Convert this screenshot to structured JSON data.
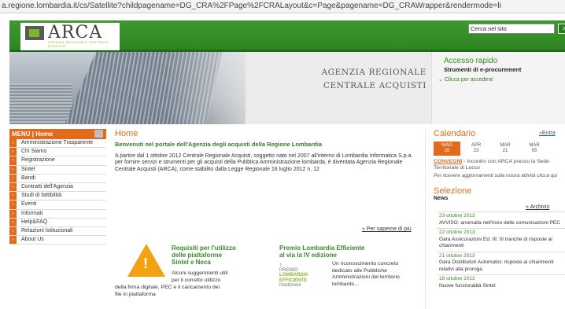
{
  "browser": {
    "url": "a.regione.lombardia.it/cs/Satellite?childpagename=DG_CRA%2FPage%2FCRALayout&c=Page&pagename=DG_CRAWrapper&rendermode=li"
  },
  "header": {
    "logo_text": "ARCA",
    "logo_sub": "AGENZIA REGIONALE CENTRALE ACQUISTI",
    "search_placeholder": "Cerca nel sito",
    "search_button": ">"
  },
  "hero": {
    "line1": "AGENZIA REGIONALE",
    "line2": "CENTRALE ACQUISTI"
  },
  "quick_access": {
    "title": "Accesso rapido",
    "subtitle": "Strumenti di e-procurement",
    "link": "Clicca per accedere"
  },
  "menu": {
    "title": "MENU",
    "home": "Home",
    "items": [
      "Amministrazione Trasparente",
      "Chi Siamo",
      "Registrazione",
      "Sintel",
      "Bandi",
      "Contratti dell'Agenzia",
      "Studi di fattibilità",
      "Eventi",
      "Informati",
      "Help&FAQ",
      "Relazioni Istituzionali",
      "About Us"
    ]
  },
  "main": {
    "title": "Home",
    "welcome": "Benvenuti nel portale dell'Agenzia degli acquisti della Regione Lombardia",
    "body": "A partire dal 1 ottobre 2012 Centrale Regionale Acquisti, soggetto nato nel 2007 all'interno di Lombardia Informatica S.p.a. per fornire servizi e strumenti per gli acquisti della Pubblica Amministrazione lombarda, è diventata Agenzia Regionale Centrale Acquisti (ARCA), come stabilito dalla Legge Regionale 16 luglio 2012 n. 12",
    "more_link": "» Per saperne di più"
  },
  "promo1": {
    "title_l1": "Requisiti per l'utilizzo",
    "title_l2": "delle piattaforme",
    "title_l3": "Sintel e Neca",
    "text_l1": "Alcuni suggerimenti utili",
    "text_l2": "per il corretto utilizzo",
    "text_l3": "della firma digitale, PEC e il caricamento dei",
    "text_l4": "file in piattaforma"
  },
  "promo2": {
    "title_l1": "Premio Lombardia Efficiente",
    "title_l2": "al via la IV edizione",
    "logo_l1": "PREMIO",
    "logo_l2": "LOMBARDIA",
    "logo_l3": "EFFICIENTE",
    "logo_l4": "IVedizione",
    "text": "Un riconoscimento concreto dedicato alle Pubbliche Amministrazioni del territorio lombardo..."
  },
  "sidebar": {
    "calendar_title": "Calendario",
    "enter_link": "»Entra",
    "days": [
      {
        "m": "MAG",
        "d": "28"
      },
      {
        "m": "APR",
        "d": "23"
      },
      {
        "m": "MAR",
        "d": "21"
      },
      {
        "m": "MAR",
        "d": "05"
      }
    ],
    "convegni_label": "CONVEGNI",
    "convegni_text": " - Incontro con ARCA presso la Sede Territoriale di Lecco",
    "notice": "Per ricevere aggiornamenti sulla nostra attività clicca qui",
    "selection_title": "Selezione",
    "news_label": "News",
    "archive_link": "» Archivio",
    "news": [
      {
        "date": "23 ottobre 2013",
        "text": "AVVISO: anomalia nell'invio delle comunicazioni PEC"
      },
      {
        "date": "22 ottobre 2013",
        "text": "Gara Assicurazioni Ed. III: III tranche di risposte ai chiarimenti"
      },
      {
        "date": "21 ottobre 2013",
        "text": "Gara Distributori Automatici: risposte ai chiarimenti relativi alla proroga"
      },
      {
        "date": "18 ottobre 2013",
        "text": "Nuove funzionalità Sintel"
      }
    ]
  }
}
